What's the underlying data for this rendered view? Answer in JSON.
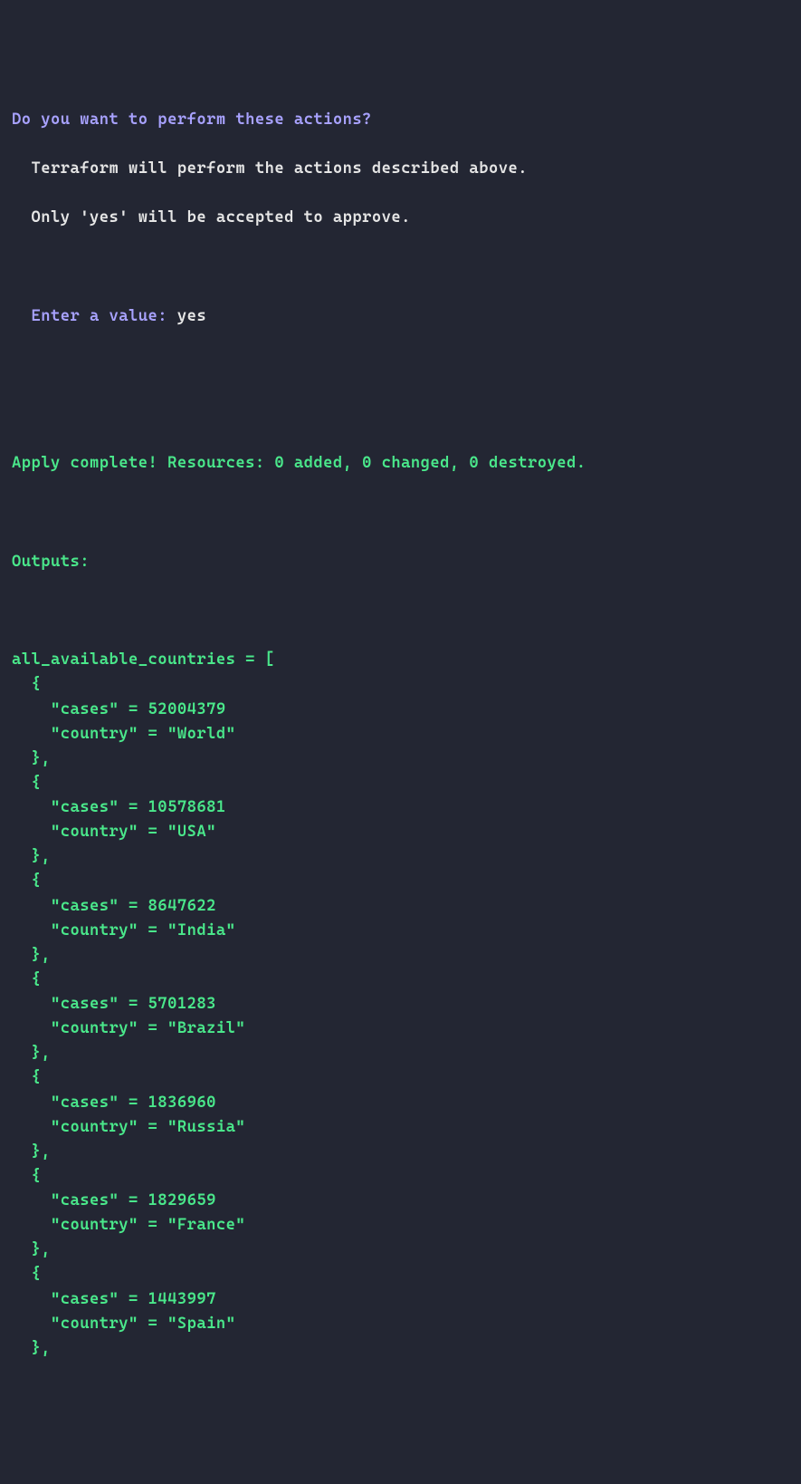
{
  "prompts": {
    "confirm_question": "Do you want to perform these actions?",
    "confirm_desc1": "  Terraform will perform the actions described above.",
    "confirm_desc2": "  Only 'yes' will be accepted to approve.",
    "enter_label": "  Enter a value: ",
    "enter_value": "yes",
    "apply_complete": "Apply complete! Resources: 0 added, 0 changed, 0 destroyed.",
    "outputs_label": "Outputs:"
  },
  "output_var": "all_available_countries",
  "key_cases": "cases",
  "key_country": "country",
  "countries": [
    {
      "cases": 52004379,
      "country": "World"
    },
    {
      "cases": 10578681,
      "country": "USA"
    },
    {
      "cases": 8647622,
      "country": "India"
    },
    {
      "cases": 5701283,
      "country": "Brazil"
    },
    {
      "cases": 1836960,
      "country": "Russia"
    },
    {
      "cases": 1829659,
      "country": "France"
    },
    {
      "cases": 1443997,
      "country": "Spain"
    }
  ]
}
